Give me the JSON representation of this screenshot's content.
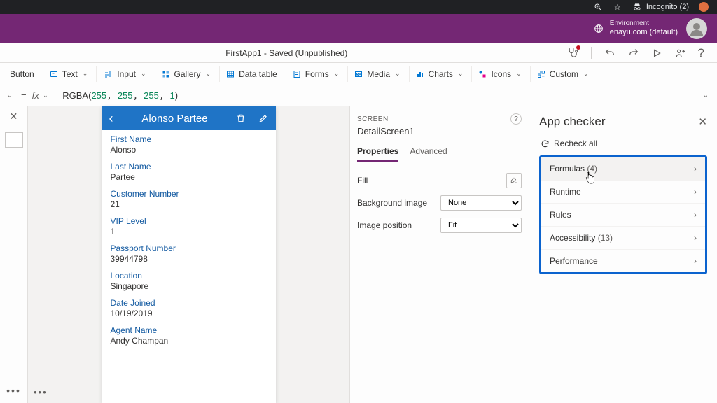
{
  "chrome": {
    "incognito_label": "Incognito (2)"
  },
  "env": {
    "label": "Environment",
    "value": "enayu.com (default)"
  },
  "titlebar": {
    "text": "FirstApp1 - Saved (Unpublished)"
  },
  "ribbon": {
    "button": "Button",
    "text": "Text",
    "input": "Input",
    "gallery": "Gallery",
    "datatable": "Data table",
    "forms": "Forms",
    "media": "Media",
    "charts": "Charts",
    "icons": "Icons",
    "custom": "Custom"
  },
  "formula": {
    "fn": "RGBA",
    "args": "(255, 255, 255, 1)"
  },
  "detail": {
    "header": "Alonso Partee",
    "fields": [
      {
        "label": "First Name",
        "value": "Alonso"
      },
      {
        "label": "Last Name",
        "value": "Partee"
      },
      {
        "label": "Customer Number",
        "value": "21"
      },
      {
        "label": "VIP Level",
        "value": "1"
      },
      {
        "label": "Passport Number",
        "value": "39944798"
      },
      {
        "label": "Location",
        "value": "Singapore"
      },
      {
        "label": "Date Joined",
        "value": "10/19/2019"
      },
      {
        "label": "Agent Name",
        "value": "Andy Champan"
      }
    ]
  },
  "props": {
    "heading_small": "SCREEN",
    "screen_name": "DetailScreen1",
    "tab_properties": "Properties",
    "tab_advanced": "Advanced",
    "fill": "Fill",
    "bg_image": "Background image",
    "bg_image_value": "None",
    "img_pos": "Image position",
    "img_pos_value": "Fit"
  },
  "checker": {
    "title": "App checker",
    "recheck": "Recheck all",
    "cats": {
      "formulas": "Formulas",
      "formulas_count": "(4)",
      "runtime": "Runtime",
      "rules": "Rules",
      "accessibility": "Accessibility",
      "accessibility_count": "(13)",
      "performance": "Performance"
    }
  }
}
